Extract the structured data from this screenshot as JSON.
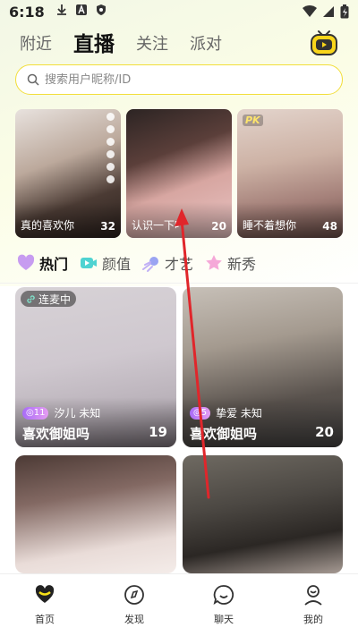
{
  "status_bar": {
    "time": "6:18"
  },
  "top_tabs": [
    {
      "label": "附近",
      "active": false
    },
    {
      "label": "直播",
      "active": true
    },
    {
      "label": "关注",
      "active": false
    },
    {
      "label": "派对",
      "active": false
    }
  ],
  "search": {
    "placeholder": "搜索用户昵称/ID"
  },
  "featured": [
    {
      "caption": "真的喜欢你",
      "count": "32"
    },
    {
      "caption": "认识一下吖",
      "count": "20"
    },
    {
      "caption": "睡不着想你",
      "count": "48",
      "badge": "PK"
    }
  ],
  "categories": [
    {
      "label": "热门",
      "active": true
    },
    {
      "label": "颜值",
      "active": false
    },
    {
      "label": "才艺",
      "active": false
    },
    {
      "label": "新秀",
      "active": false
    }
  ],
  "rooms": [
    {
      "badge": "连麦中",
      "level": "11",
      "host": "汐儿 未知",
      "title": "喜欢御姐吗",
      "count": "19"
    },
    {
      "level": "5",
      "host": "挚爱 未知",
      "title": "喜欢御姐吗",
      "count": "20"
    },
    {},
    {}
  ],
  "bottom_nav": [
    {
      "label": "首页",
      "active": true
    },
    {
      "label": "发现",
      "active": false
    },
    {
      "label": "聊天",
      "active": false
    },
    {
      "label": "我的",
      "active": false
    }
  ],
  "colors": {
    "accent": "#f8e21a",
    "annotation": "#e0262b",
    "level_badge": "#a86cf7"
  }
}
